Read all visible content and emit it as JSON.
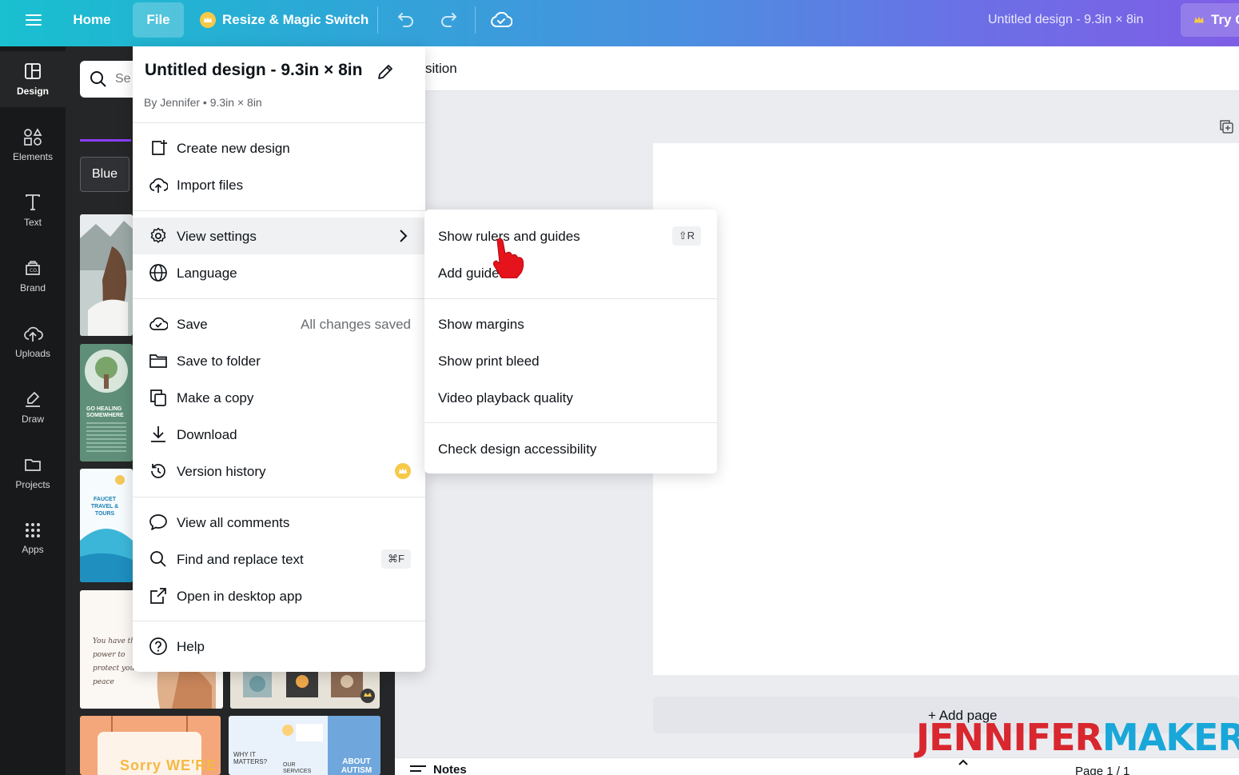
{
  "topbar": {
    "home": "Home",
    "file": "File",
    "resize": "Resize & Magic Switch",
    "doc_title": "Untitled design - 9.3in × 8in",
    "try": "Try C"
  },
  "rail": {
    "items": [
      {
        "label": "Design"
      },
      {
        "label": "Elements"
      },
      {
        "label": "Text"
      },
      {
        "label": "Brand"
      },
      {
        "label": "Uploads"
      },
      {
        "label": "Draw"
      },
      {
        "label": "Projects"
      },
      {
        "label": "Apps"
      }
    ]
  },
  "panel": {
    "search_text": "Se",
    "chip": "Blue",
    "thumbs": {
      "t2": "GO HEALING SOMEWHERE",
      "t3": "FAUCET TRAVEL & TOURS",
      "t4": "You have the power to protect your peace",
      "t5": "Sorry WE'RE",
      "t6a": "WHY IT MATTERS?",
      "t6b": "OUR SERVICES",
      "t6c": "ABOUT AUTISM"
    }
  },
  "canvas": {
    "toolbar_label": "sition",
    "add_page": "+ Add page",
    "notes": "Notes",
    "page_count": "Page 1 / 1"
  },
  "watermark": {
    "part1": "JENNIFER",
    "part2": "MAKER"
  },
  "file_menu": {
    "title": "Untitled design - 9.3in × 8in",
    "subtitle": "By Jennifer • 9.3in × 8in",
    "items": {
      "create_new": "Create new design",
      "import": "Import files",
      "view_settings": "View settings",
      "language": "Language",
      "save": "Save",
      "save_status": "All changes saved",
      "save_to_folder": "Save to folder",
      "make_copy": "Make a copy",
      "download": "Download",
      "version_history": "Version history",
      "view_comments": "View all comments",
      "find_replace": "Find and replace text",
      "find_replace_shortcut": "⌘F",
      "open_desktop": "Open in desktop app",
      "help": "Help"
    }
  },
  "view_settings_menu": {
    "show_rulers": "Show rulers and guides",
    "show_rulers_shortcut": "⇧R",
    "add_guides": "Add guides",
    "show_margins": "Show margins",
    "show_print_bleed": "Show print bleed",
    "video_quality": "Video playback quality",
    "check_accessibility": "Check design accessibility"
  },
  "colors": {
    "accent": "#8b3dff",
    "crown": "#f7c948",
    "watermark_red": "#d8272e",
    "watermark_blue": "#18a7d8"
  }
}
